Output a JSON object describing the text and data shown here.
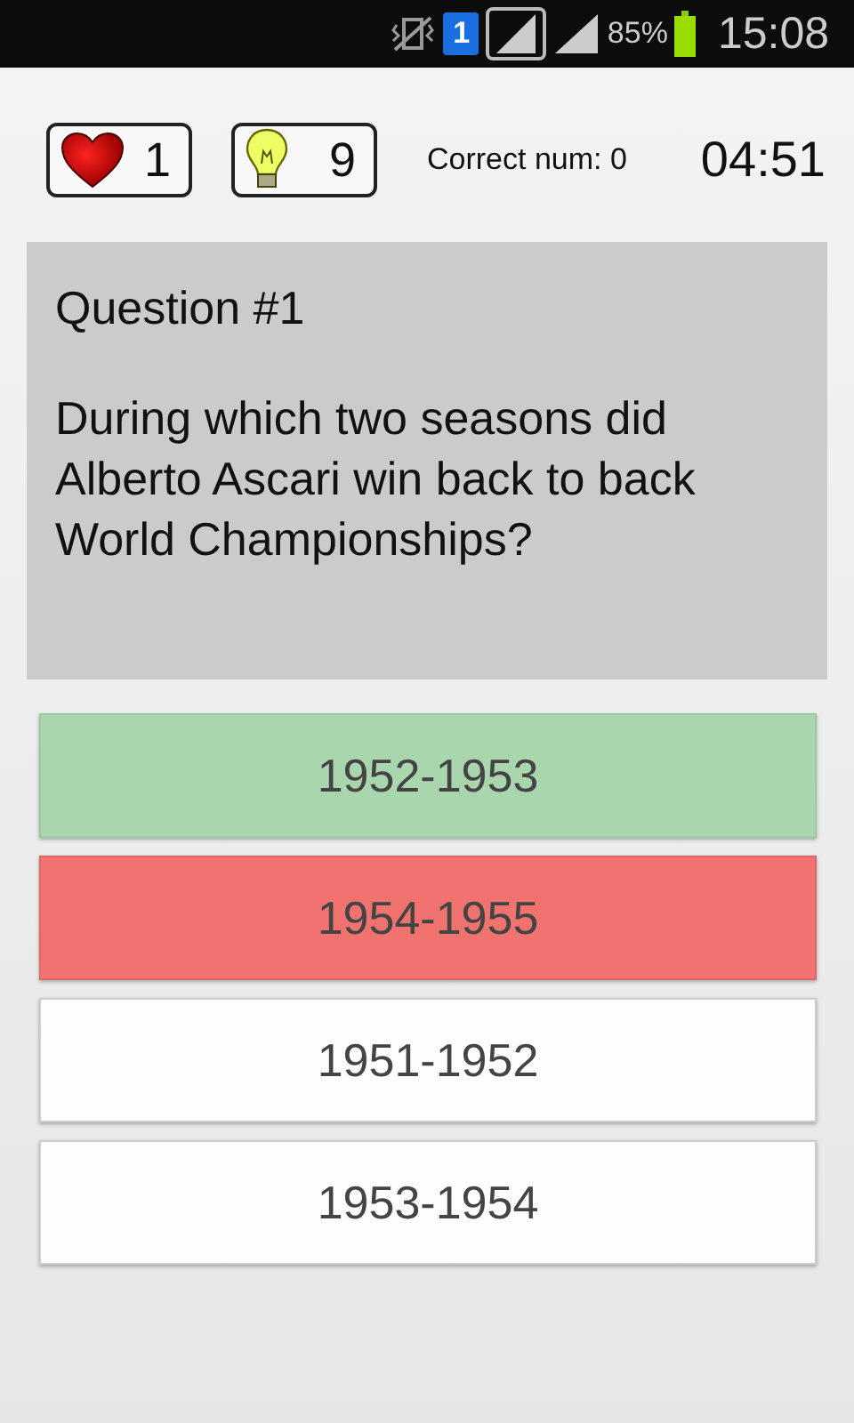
{
  "status_bar": {
    "sim_badge": "1",
    "battery": "85%",
    "time": "15:08"
  },
  "header": {
    "lives": "1",
    "hints": "9",
    "correct": "Correct num: 0",
    "timer": "04:51"
  },
  "question": {
    "number": "Question #1",
    "text": "During which two seasons did Alberto Ascari win back to back World Championships?"
  },
  "answers": [
    {
      "label": "1952-1953",
      "kind": "correct"
    },
    {
      "label": "1954-1955",
      "kind": "wrong"
    },
    {
      "label": "1951-1952",
      "kind": "plain"
    },
    {
      "label": "1953-1954",
      "kind": "plain"
    }
  ]
}
